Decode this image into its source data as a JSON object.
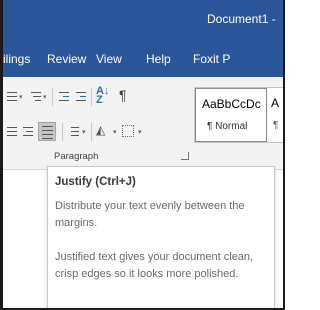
{
  "window": {
    "title": "Document1 -"
  },
  "tabs": [
    "ilings",
    "Review",
    "View",
    "Help",
    "Foxit P"
  ],
  "ribbon": {
    "paragraph_group_label": "Paragraph",
    "styles": {
      "sample_text": "AaBbCcDc",
      "normal_label": "¶ Normal",
      "next_sample": "A",
      "next_label": "¶"
    }
  },
  "tooltip": {
    "title": "Justify (Ctrl+J)",
    "description": "Distribute your text evenly between the margins.",
    "detail": "Justified text gives your document clean, crisp edges so it looks more polished."
  },
  "colors": {
    "title_bar": "#2b579a",
    "ribbon_bg": "#f3f3f3",
    "selected_button": "#c5c5c5"
  }
}
